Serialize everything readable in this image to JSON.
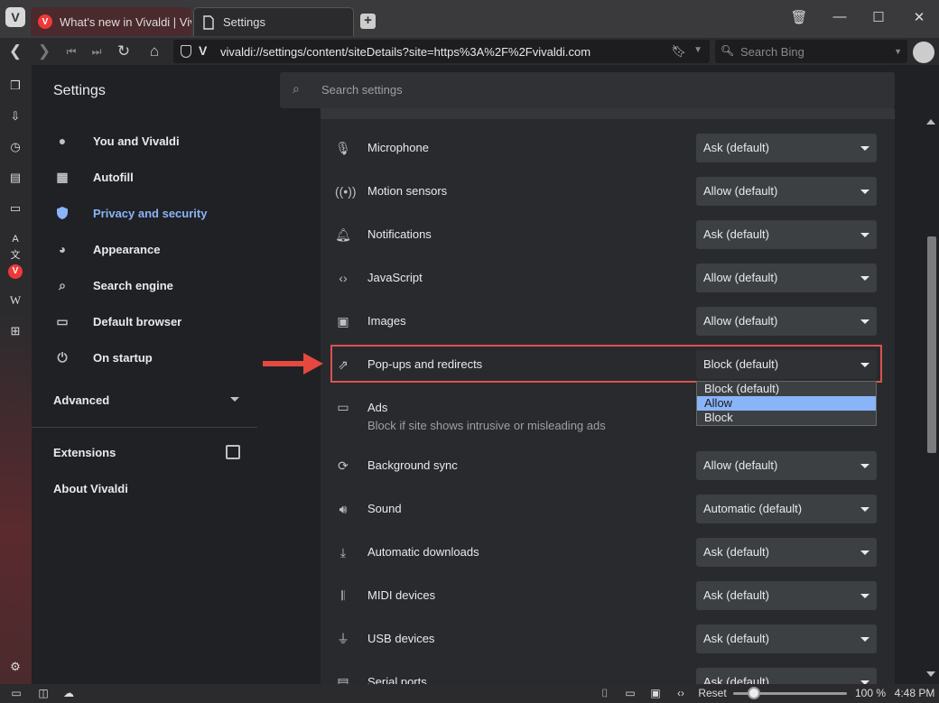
{
  "tabs": [
    {
      "label": "What's new in Vivaldi | Viva"
    },
    {
      "label": "Settings"
    }
  ],
  "window_buttons": {
    "trash": "🗑",
    "minimize": "—",
    "maximize": "☐",
    "close": "✕"
  },
  "address_bar": {
    "url": "vivaldi://settings/content/siteDetails?site=https%3A%2F%2Fvivaldi.com",
    "site_badge": "V"
  },
  "search_bar": {
    "placeholder": "Search Bing"
  },
  "sidebar": {
    "title": "Settings",
    "items": [
      {
        "label": "You and Vivaldi",
        "icon": "person-icon"
      },
      {
        "label": "Autofill",
        "icon": "clipboard-icon"
      },
      {
        "label": "Privacy and security",
        "icon": "shield-icon"
      },
      {
        "label": "Appearance",
        "icon": "palette-icon"
      },
      {
        "label": "Search engine",
        "icon": "search-icon"
      },
      {
        "label": "Default browser",
        "icon": "browser-icon"
      },
      {
        "label": "On startup",
        "icon": "power-icon"
      }
    ],
    "advanced_label": "Advanced",
    "extensions_label": "Extensions",
    "about_label": "About Vivaldi"
  },
  "settings_search": {
    "placeholder": "Search settings"
  },
  "permissions": [
    {
      "label": "Microphone",
      "value": "Ask (default)",
      "icon": "microphone-icon"
    },
    {
      "label": "Motion sensors",
      "value": "Allow (default)",
      "icon": "sensors-icon"
    },
    {
      "label": "Notifications",
      "value": "Ask (default)",
      "icon": "bell-icon"
    },
    {
      "label": "JavaScript",
      "value": "Allow (default)",
      "icon": "code-icon"
    },
    {
      "label": "Images",
      "value": "Allow (default)",
      "icon": "image-icon"
    },
    {
      "label": "Pop-ups and redirects",
      "value": "Block (default)",
      "icon": "open-external-icon"
    },
    {
      "label": "Ads",
      "sublabel": "Block if site shows intrusive or misleading ads",
      "value": "",
      "icon": "ads-icon"
    },
    {
      "label": "Background sync",
      "value": "Allow (default)",
      "icon": "sync-icon"
    },
    {
      "label": "Sound",
      "value": "Automatic (default)",
      "icon": "speaker-icon"
    },
    {
      "label": "Automatic downloads",
      "value": "Ask (default)",
      "icon": "download-icon"
    },
    {
      "label": "MIDI devices",
      "value": "Ask (default)",
      "icon": "piano-icon"
    },
    {
      "label": "USB devices",
      "value": "Ask (default)",
      "icon": "usb-icon"
    },
    {
      "label": "Serial ports",
      "value": "Ask (default)",
      "icon": "serial-icon"
    }
  ],
  "popup_dropdown": {
    "options": [
      "Block (default)",
      "Allow",
      "Block"
    ],
    "highlighted": "Allow"
  },
  "status_bar": {
    "reset_label": "Reset",
    "zoom": "100 %",
    "time": "4:48 PM"
  },
  "colors": {
    "accent": "#8ab4f8",
    "annotation_red": "#e5483f"
  }
}
